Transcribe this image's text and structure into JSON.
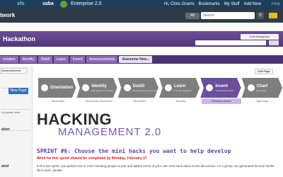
{
  "topbar": {
    "brand_left": "sfo",
    "brand_saba": "saba",
    "brand_enterprise": "Enterprise 2.0",
    "user_nav": [
      "Hi, Chris Grams",
      "Bookmarks",
      "My Stuff",
      "Add New"
    ],
    "help": "Help"
  },
  "subbar": {
    "network_label": "twork",
    "scope": "All",
    "search_placeholder": "Search"
  },
  "page": {
    "title": "Hackathon",
    "edit_button": "Edit Workspace"
  },
  "tabs": [
    {
      "label": "entation"
    },
    {
      "label": "Identify"
    },
    {
      "label": "Distill"
    },
    {
      "label": "Learn"
    },
    {
      "label": "Invent"
    },
    {
      "label": "Announcements"
    },
    {
      "label": "Awesome New..."
    }
  ],
  "left_panel": {
    "announcement_button": "Announcement",
    "new_page_button": "New Page",
    "popular_label": "d popular ones",
    "section1": "ation",
    "section2": "ated"
  },
  "content": {
    "edit_page_button": "Edit Page",
    "stages": [
      {
        "name": "Orientation",
        "sub": "",
        "icon": "info-icon"
      },
      {
        "name": "Identify",
        "sub": "Management 2.0 hacks",
        "icon": "magnify-icon"
      },
      {
        "name": "Distill",
        "sub": "Management 2.0 principles",
        "icon": "funnel-icon"
      },
      {
        "name": "Learn",
        "sub": "from the vanguard",
        "icon": "person-icon"
      },
      {
        "name": "Invent",
        "sub": "management hacks",
        "icon": "network-icon"
      },
      {
        "name": "Chart",
        "sub": "the course",
        "icon": "chart-icon"
      }
    ],
    "months": [
      "November",
      "November-December",
      "December",
      "January",
      "February-March",
      "April-May"
    ],
    "active_month_index": 4,
    "hero_line1": "HACKING",
    "hero_line2": "MANAGEMENT 2.0",
    "sprint_heading": "SPRINT #6: Choose the mini hacks you want to help develop",
    "deadline": "Work for this sprint should be completed by Monday, February 27",
    "paragraph": "In the last sprint, you picked one or more hacking groups to join and added some of your own mini hack ideas to the discussion. As a group, we generated 60 mini hacks. Nice work, people."
  }
}
